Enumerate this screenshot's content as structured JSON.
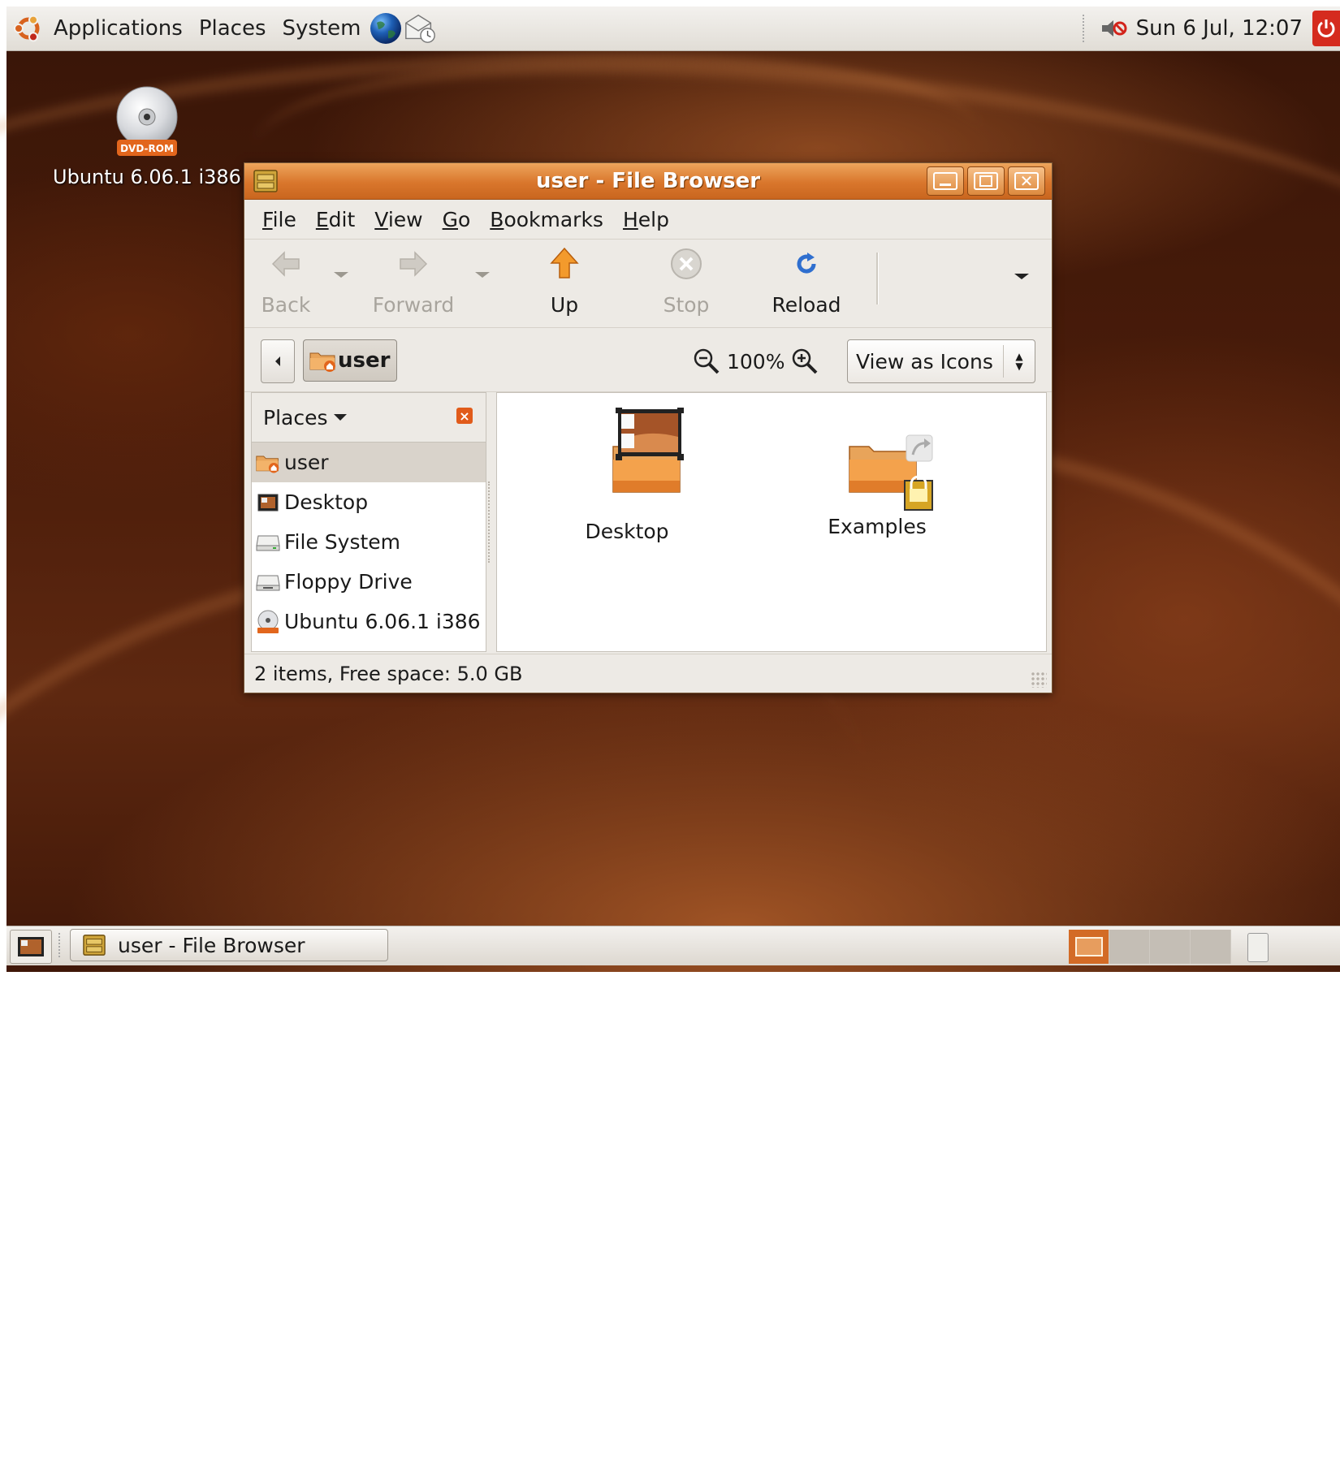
{
  "top_panel": {
    "menus": [
      "Applications",
      "Places",
      "System"
    ],
    "clock": "Sun  6 Jul, 12:07"
  },
  "desktop": {
    "dvd_badge": "DVD-ROM",
    "dvd_label": "Ubuntu 6.06.1 i386"
  },
  "window": {
    "title": "user - File Browser",
    "menu": [
      {
        "accel": "F",
        "rest": "ile"
      },
      {
        "accel": "E",
        "rest": "dit"
      },
      {
        "accel": "V",
        "rest": "iew"
      },
      {
        "accel": "G",
        "rest": "o"
      },
      {
        "accel": "B",
        "rest": "ookmarks"
      },
      {
        "accel": "H",
        "rest": "elp"
      }
    ],
    "toolbar": {
      "back": "Back",
      "forward": "Forward",
      "up": "Up",
      "stop": "Stop",
      "reload": "Reload"
    },
    "location": {
      "crumb": "user",
      "zoom": "100%",
      "view_mode": "View as Icons"
    },
    "sidebar": {
      "title": "Places",
      "items": [
        {
          "label": "user",
          "icon": "home-folder-icon"
        },
        {
          "label": "Desktop",
          "icon": "desktop-icon"
        },
        {
          "label": "File System",
          "icon": "harddisk-icon"
        },
        {
          "label": "Floppy Drive",
          "icon": "floppy-icon"
        },
        {
          "label": "Ubuntu 6.06.1 i386",
          "icon": "cdrom-icon"
        }
      ]
    },
    "files": [
      {
        "label": "Desktop",
        "icon": "desktop-folder-icon"
      },
      {
        "label": "Examples",
        "icon": "locked-symlink-folder-icon"
      }
    ],
    "status": "2 items, Free space: 5.0 GB"
  },
  "bottom_panel": {
    "task": "user - File Browser"
  },
  "colors": {
    "accent": "#d9762c",
    "desktop_bg": "#4a1c0a",
    "panel_bg": "#e8e5e0"
  }
}
